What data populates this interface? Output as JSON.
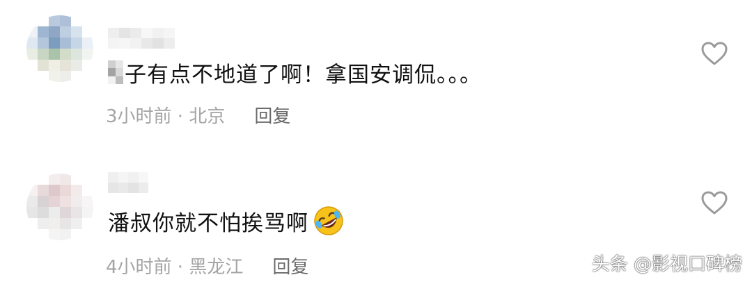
{
  "comments": [
    {
      "text": "子有点不地道了啊！拿国安调侃。。。",
      "time": "3小时前",
      "location": "北京",
      "reply_label": "回复",
      "avatar_colors": [
        "#ffffff",
        "#ffffff",
        "#b9c9de",
        "#aec0d8",
        "#ffffff",
        "#ffffff",
        "#eef2f7",
        "#9fb6d2",
        "#8fa7c5",
        "#bfcfe2",
        "#d7e2ef",
        "#ffffff",
        "#dfe8f1",
        "#b3c6db",
        "#7d9dbf",
        "#a8bed6",
        "#c6d6e6",
        "#eaf0f6",
        "#e8eee4",
        "#c9d6c4",
        "#aac4a9",
        "#d2dcc8",
        "#dce6df",
        "#f1f4f0",
        "#ffffff",
        "#e3e3d5",
        "#f0efe6",
        "#e6e3d8",
        "#e9ece6",
        "#ffffff",
        "#ffffff",
        "#ffffff",
        "#f1f1ec",
        "#ededea",
        "#ffffff",
        "#ffffff"
      ],
      "name_colors": [
        "#eeeeee",
        "#f4f4f4",
        "#e4e4e4",
        "#f6f6f6",
        "#ebebeb",
        "#f2f2f2",
        "#f7f7f7",
        "#e8e8e8",
        "#f1f1f1",
        "#e2e2e2",
        "#f5f5f5",
        "#ededed"
      ],
      "text_mosaic_colors": [
        "#cfcfcf",
        "#e6e6e6",
        "#a3a3a3",
        "#d9d9d9",
        "#f2f2f2",
        "#bdbdbd"
      ]
    },
    {
      "text": "潘叔你就不怕挨骂啊",
      "time": "4小时前",
      "location": "黑龙江",
      "reply_label": "回复",
      "avatar_colors": [
        "#ffffff",
        "#ffffff",
        "#f3eded",
        "#f0e8e8",
        "#ffffff",
        "#ffffff",
        "#f6f0f0",
        "#e8d9db",
        "#ddc8cb",
        "#ead9d8",
        "#f3eaea",
        "#ffffff",
        "#eaeaea",
        "#d9d2d4",
        "#e6d3d6",
        "#efe1e1",
        "#f2eded",
        "#f7f5f5",
        "#e6e6e6",
        "#dcdcdc",
        "#ececec",
        "#ded6d8",
        "#e9e4e5",
        "#f4f4f4",
        "#ffffff",
        "#eeeeee",
        "#f1eeee",
        "#e7e5e5",
        "#efefef",
        "#ffffff",
        "#ffffff",
        "#ffffff",
        "#f4f4f4",
        "#f2f2f2",
        "#ffffff",
        "#ffffff"
      ],
      "name_colors": [
        "#efefef",
        "#e6e6e6",
        "#f5f5f5",
        "#e9e9e9",
        "#f1f1f1",
        "#e3e3e3",
        "#f7f7f7",
        "#ececec"
      ]
    }
  ],
  "icons": {
    "like": "heart-outline-icon",
    "emoji": "rolling-on-floor-laughing-emoji"
  },
  "colors": {
    "text": "#111111",
    "meta": "#a4a4a4",
    "reply": "#6b6b6b",
    "heart": "#9a9a9a",
    "emoji_face": "#f7c21a"
  },
  "watermark": "头条 @影视口碑榜"
}
